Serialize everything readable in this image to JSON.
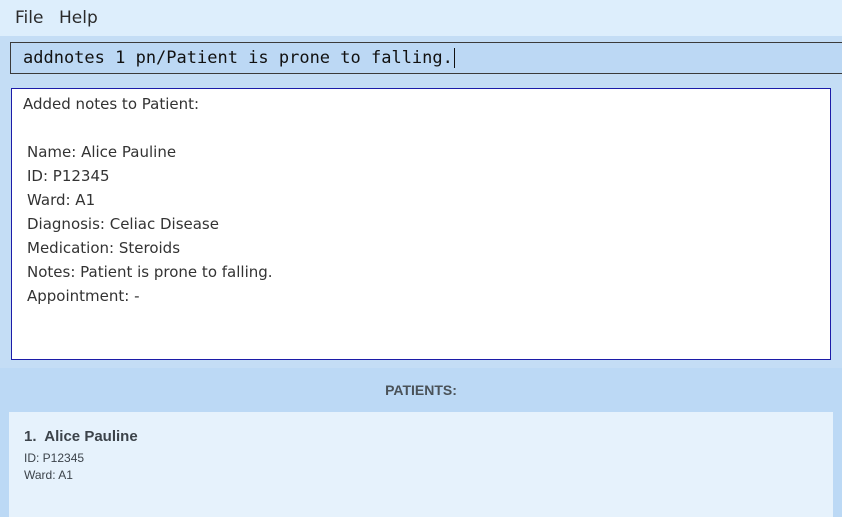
{
  "menu": {
    "file_label": "File",
    "help_label": "Help"
  },
  "command_box": {
    "value": "addnotes 1 pn/Patient is prone to falling."
  },
  "result": {
    "heading": "Added notes to Patient:",
    "lines": [
      "Name: Alice Pauline",
      "ID: P12345",
      "Ward: A1",
      "Diagnosis: Celiac Disease",
      "Medication: Steroids",
      "Notes: Patient is prone to falling.",
      "Appointment: -"
    ]
  },
  "patient_list": {
    "header": "PATIENTS:",
    "items": [
      {
        "index": "1.",
        "name": "Alice Pauline",
        "id_line": "ID: P12345",
        "ward_line": "Ward: A1"
      }
    ]
  },
  "colors": {
    "background": "#bcd9f5",
    "menubar": "#ddeefc",
    "result_border": "#1c1ca8",
    "card": "#e6f2fc"
  }
}
